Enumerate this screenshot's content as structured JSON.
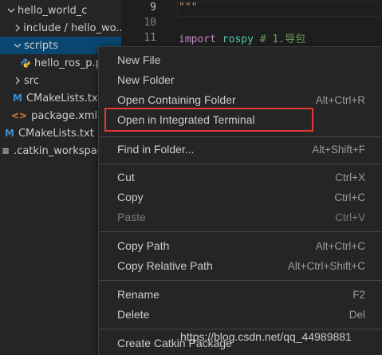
{
  "sidebar": {
    "items": [
      {
        "label": "hello_world_c",
        "icon": "chevron-down-icon"
      },
      {
        "label": "include / hello_wo...",
        "icon": "chevron-right-icon"
      },
      {
        "label": "scripts",
        "icon": "chevron-down-icon",
        "selected": true
      },
      {
        "label": "hello_ros_p.py",
        "icon": "python-file-icon"
      },
      {
        "label": "src",
        "icon": "chevron-right-icon"
      },
      {
        "label": "CMakeLists.txt",
        "icon": "cmake-file-icon",
        "icon_glyph": "M"
      },
      {
        "label": "package.xml",
        "icon": "xml-file-icon",
        "icon_glyph": "<>"
      },
      {
        "label": "CMakeLists.txt",
        "icon": "cmake-file-icon",
        "icon_glyph": "M"
      },
      {
        "label": ".catkin_workspace",
        "icon": "file-lines-icon",
        "icon_glyph": "≡"
      }
    ]
  },
  "editor": {
    "lines": [
      {
        "number": "9",
        "text": "\"\"\""
      },
      {
        "number": "10",
        "text": ""
      },
      {
        "number": "11",
        "keyword": "import",
        "module": "rospy",
        "comment": "# 1.导包"
      }
    ]
  },
  "context_menu": {
    "groups": [
      [
        {
          "label": "New File",
          "shortcut": ""
        },
        {
          "label": "New Folder",
          "shortcut": ""
        },
        {
          "label": "Open Containing Folder",
          "shortcut": "Alt+Ctrl+R"
        },
        {
          "label": "Open in Integrated Terminal",
          "shortcut": "",
          "highlighted": true
        }
      ],
      [
        {
          "label": "Find in Folder...",
          "shortcut": "Alt+Shift+F"
        }
      ],
      [
        {
          "label": "Cut",
          "shortcut": "Ctrl+X"
        },
        {
          "label": "Copy",
          "shortcut": "Ctrl+C"
        },
        {
          "label": "Paste",
          "shortcut": "Ctrl+V",
          "disabled": true
        }
      ],
      [
        {
          "label": "Copy Path",
          "shortcut": "Alt+Ctrl+C"
        },
        {
          "label": "Copy Relative Path",
          "shortcut": "Alt+Ctrl+Shift+C"
        }
      ],
      [
        {
          "label": "Rename",
          "shortcut": "F2"
        },
        {
          "label": "Delete",
          "shortcut": "Del"
        }
      ],
      [
        {
          "label": "Create Catkin Package",
          "shortcut": ""
        }
      ]
    ]
  },
  "highlight_color": "#e53935",
  "watermark": "https://blog.csdn.net/qq_44989881"
}
